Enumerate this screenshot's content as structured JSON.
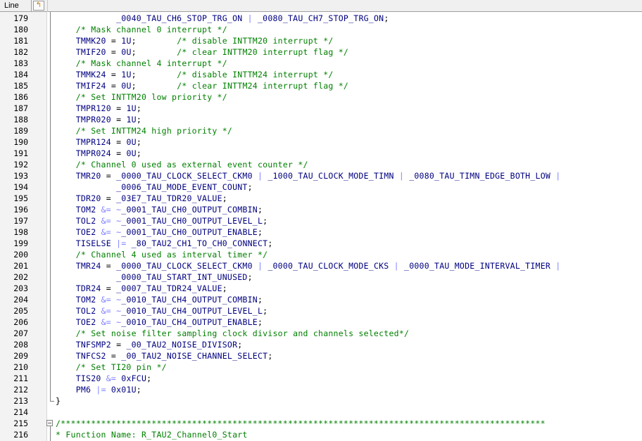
{
  "header": {
    "line_label": "Line",
    "icon": "bookmark-arrow-icon"
  },
  "colors": {
    "identifier": "#000080",
    "operator": "#8080ff",
    "comment": "#008000",
    "plain": "#000000"
  },
  "lines": [
    {
      "num": "179",
      "tokens": [
        {
          "t": "            _0040_TAU_CH6_STOP_TRG_ON",
          "c": "kw"
        },
        {
          "t": " | ",
          "c": "op"
        },
        {
          "t": "_0080_TAU_CH7_STOP_TRG_ON",
          "c": "kw"
        },
        {
          "t": ";",
          "c": "pl"
        }
      ]
    },
    {
      "num": "180",
      "tokens": [
        {
          "t": "    /* Mask channel 0 interrupt */",
          "c": "cm"
        }
      ]
    },
    {
      "num": "181",
      "tokens": [
        {
          "t": "    TMMK20",
          "c": "kw"
        },
        {
          "t": " = ",
          "c": "pl"
        },
        {
          "t": "1U",
          "c": "kw"
        },
        {
          "t": ";        ",
          "c": "pl"
        },
        {
          "t": "/* disable INTTM20 interrupt */",
          "c": "cm"
        }
      ]
    },
    {
      "num": "182",
      "tokens": [
        {
          "t": "    TMIF20",
          "c": "kw"
        },
        {
          "t": " = ",
          "c": "pl"
        },
        {
          "t": "0U",
          "c": "kw"
        },
        {
          "t": ";        ",
          "c": "pl"
        },
        {
          "t": "/* clear INTTM20 interrupt flag */",
          "c": "cm"
        }
      ]
    },
    {
      "num": "183",
      "tokens": [
        {
          "t": "    /* Mask channel 4 interrupt */",
          "c": "cm"
        }
      ]
    },
    {
      "num": "184",
      "tokens": [
        {
          "t": "    TMMK24",
          "c": "kw"
        },
        {
          "t": " = ",
          "c": "pl"
        },
        {
          "t": "1U",
          "c": "kw"
        },
        {
          "t": ";        ",
          "c": "pl"
        },
        {
          "t": "/* disable INTTM24 interrupt */",
          "c": "cm"
        }
      ]
    },
    {
      "num": "185",
      "tokens": [
        {
          "t": "    TMIF24",
          "c": "kw"
        },
        {
          "t": " = ",
          "c": "pl"
        },
        {
          "t": "0U",
          "c": "kw"
        },
        {
          "t": ";        ",
          "c": "pl"
        },
        {
          "t": "/* clear INTTM24 interrupt flag */",
          "c": "cm"
        }
      ]
    },
    {
      "num": "186",
      "tokens": [
        {
          "t": "    /* Set INTTM20 low priority */",
          "c": "cm"
        }
      ]
    },
    {
      "num": "187",
      "tokens": [
        {
          "t": "    TMPR120",
          "c": "kw"
        },
        {
          "t": " = ",
          "c": "pl"
        },
        {
          "t": "1U",
          "c": "kw"
        },
        {
          "t": ";",
          "c": "pl"
        }
      ]
    },
    {
      "num": "188",
      "tokens": [
        {
          "t": "    TMPR020",
          "c": "kw"
        },
        {
          "t": " = ",
          "c": "pl"
        },
        {
          "t": "1U",
          "c": "kw"
        },
        {
          "t": ";",
          "c": "pl"
        }
      ]
    },
    {
      "num": "189",
      "tokens": [
        {
          "t": "    /* Set INTTM24 high priority */",
          "c": "cm"
        }
      ]
    },
    {
      "num": "190",
      "tokens": [
        {
          "t": "    TMPR124",
          "c": "kw"
        },
        {
          "t": " = ",
          "c": "pl"
        },
        {
          "t": "0U",
          "c": "kw"
        },
        {
          "t": ";",
          "c": "pl"
        }
      ]
    },
    {
      "num": "191",
      "tokens": [
        {
          "t": "    TMPR024",
          "c": "kw"
        },
        {
          "t": " = ",
          "c": "pl"
        },
        {
          "t": "0U",
          "c": "kw"
        },
        {
          "t": ";",
          "c": "pl"
        }
      ]
    },
    {
      "num": "192",
      "tokens": [
        {
          "t": "    /* Channel 0 used as external event counter */",
          "c": "cm"
        }
      ]
    },
    {
      "num": "193",
      "tokens": [
        {
          "t": "    TMR20",
          "c": "kw"
        },
        {
          "t": " = ",
          "c": "pl"
        },
        {
          "t": "_0000_TAU_CLOCK_SELECT_CKM0",
          "c": "kw"
        },
        {
          "t": " | ",
          "c": "op"
        },
        {
          "t": "_1000_TAU_CLOCK_MODE_TIMN",
          "c": "kw"
        },
        {
          "t": " | ",
          "c": "op"
        },
        {
          "t": "_0080_TAU_TIMN_EDGE_BOTH_LOW",
          "c": "kw"
        },
        {
          "t": " |",
          "c": "op"
        }
      ]
    },
    {
      "num": "194",
      "tokens": [
        {
          "t": "            _0006_TAU_MODE_EVENT_COUNT",
          "c": "kw"
        },
        {
          "t": ";",
          "c": "pl"
        }
      ]
    },
    {
      "num": "195",
      "tokens": [
        {
          "t": "    TDR20",
          "c": "kw"
        },
        {
          "t": " = ",
          "c": "pl"
        },
        {
          "t": "_03E7_TAU_TDR20_VALUE",
          "c": "kw"
        },
        {
          "t": ";",
          "c": "pl"
        }
      ]
    },
    {
      "num": "196",
      "tokens": [
        {
          "t": "    TOM2",
          "c": "kw"
        },
        {
          "t": " &= ",
          "c": "op"
        },
        {
          "t": "~",
          "c": "op"
        },
        {
          "t": "_0001_TAU_CH0_OUTPUT_COMBIN",
          "c": "kw"
        },
        {
          "t": ";",
          "c": "pl"
        }
      ]
    },
    {
      "num": "197",
      "tokens": [
        {
          "t": "    TOL2",
          "c": "kw"
        },
        {
          "t": " &= ",
          "c": "op"
        },
        {
          "t": "~",
          "c": "op"
        },
        {
          "t": "_0001_TAU_CH0_OUTPUT_LEVEL_L",
          "c": "kw"
        },
        {
          "t": ";",
          "c": "pl"
        }
      ]
    },
    {
      "num": "198",
      "tokens": [
        {
          "t": "    TOE2",
          "c": "kw"
        },
        {
          "t": " &= ",
          "c": "op"
        },
        {
          "t": "~",
          "c": "op"
        },
        {
          "t": "_0001_TAU_CH0_OUTPUT_ENABLE",
          "c": "kw"
        },
        {
          "t": ";",
          "c": "pl"
        }
      ]
    },
    {
      "num": "199",
      "tokens": [
        {
          "t": "    TISELSE",
          "c": "kw"
        },
        {
          "t": " |= ",
          "c": "op"
        },
        {
          "t": "_80_TAU2_CH1_TO_CH0_CONNECT",
          "c": "kw"
        },
        {
          "t": ";",
          "c": "pl"
        }
      ]
    },
    {
      "num": "200",
      "tokens": [
        {
          "t": "    /* Channel 4 used as interval timer */",
          "c": "cm"
        }
      ]
    },
    {
      "num": "201",
      "tokens": [
        {
          "t": "    TMR24",
          "c": "kw"
        },
        {
          "t": " = ",
          "c": "pl"
        },
        {
          "t": "_0000_TAU_CLOCK_SELECT_CKM0",
          "c": "kw"
        },
        {
          "t": " | ",
          "c": "op"
        },
        {
          "t": "_0000_TAU_CLOCK_MODE_CKS",
          "c": "kw"
        },
        {
          "t": " | ",
          "c": "op"
        },
        {
          "t": "_0000_TAU_MODE_INTERVAL_TIMER",
          "c": "kw"
        },
        {
          "t": " |",
          "c": "op"
        }
      ]
    },
    {
      "num": "202",
      "tokens": [
        {
          "t": "            _0000_TAU_START_INT_UNUSED",
          "c": "kw"
        },
        {
          "t": ";",
          "c": "pl"
        }
      ]
    },
    {
      "num": "203",
      "tokens": [
        {
          "t": "    TDR24",
          "c": "kw"
        },
        {
          "t": " = ",
          "c": "pl"
        },
        {
          "t": "_0007_TAU_TDR24_VALUE",
          "c": "kw"
        },
        {
          "t": ";",
          "c": "pl"
        }
      ]
    },
    {
      "num": "204",
      "tokens": [
        {
          "t": "    TOM2",
          "c": "kw"
        },
        {
          "t": " &= ",
          "c": "op"
        },
        {
          "t": "~",
          "c": "op"
        },
        {
          "t": "_0010_TAU_CH4_OUTPUT_COMBIN",
          "c": "kw"
        },
        {
          "t": ";",
          "c": "pl"
        }
      ]
    },
    {
      "num": "205",
      "tokens": [
        {
          "t": "    TOL2",
          "c": "kw"
        },
        {
          "t": " &= ",
          "c": "op"
        },
        {
          "t": "~",
          "c": "op"
        },
        {
          "t": "_0010_TAU_CH4_OUTPUT_LEVEL_L",
          "c": "kw"
        },
        {
          "t": ";",
          "c": "pl"
        }
      ]
    },
    {
      "num": "206",
      "tokens": [
        {
          "t": "    TOE2",
          "c": "kw"
        },
        {
          "t": " &= ",
          "c": "op"
        },
        {
          "t": "~",
          "c": "op"
        },
        {
          "t": "_0010_TAU_CH4_OUTPUT_ENABLE",
          "c": "kw"
        },
        {
          "t": ";",
          "c": "pl"
        }
      ]
    },
    {
      "num": "207",
      "tokens": [
        {
          "t": "    /* Set noise filter sampling clock divisor and channels selected*/",
          "c": "cm"
        }
      ]
    },
    {
      "num": "208",
      "tokens": [
        {
          "t": "    TNFSMP2",
          "c": "kw"
        },
        {
          "t": " = ",
          "c": "pl"
        },
        {
          "t": "_00_TAU2_NOISE_DIVISOR",
          "c": "kw"
        },
        {
          "t": ";",
          "c": "pl"
        }
      ]
    },
    {
      "num": "209",
      "tokens": [
        {
          "t": "    TNFCS2",
          "c": "kw"
        },
        {
          "t": " = ",
          "c": "pl"
        },
        {
          "t": "_00_TAU2_NOISE_CHANNEL_SELECT",
          "c": "kw"
        },
        {
          "t": ";",
          "c": "pl"
        }
      ]
    },
    {
      "num": "210",
      "tokens": [
        {
          "t": "    /* Set TI20 pin */",
          "c": "cm"
        }
      ]
    },
    {
      "num": "211",
      "tokens": [
        {
          "t": "    TIS20",
          "c": "kw"
        },
        {
          "t": " &= ",
          "c": "op"
        },
        {
          "t": "0xFCU",
          "c": "kw"
        },
        {
          "t": ";",
          "c": "pl"
        }
      ]
    },
    {
      "num": "212",
      "tokens": [
        {
          "t": "    PM6",
          "c": "kw"
        },
        {
          "t": " |= ",
          "c": "op"
        },
        {
          "t": "0x01U",
          "c": "kw"
        },
        {
          "t": ";",
          "c": "pl"
        }
      ]
    },
    {
      "num": "213",
      "tokens": [
        {
          "t": "}",
          "c": "pl"
        }
      ]
    },
    {
      "num": "214",
      "tokens": []
    },
    {
      "num": "215",
      "tokens": [
        {
          "t": "/************************************************************************************************",
          "c": "cm"
        }
      ]
    },
    {
      "num": "216",
      "tokens": [
        {
          "t": "* Function Name: R_TAU2_Channel0_Start",
          "c": "cm"
        }
      ]
    }
  ],
  "fold": {
    "collapse_glyph": "−"
  }
}
